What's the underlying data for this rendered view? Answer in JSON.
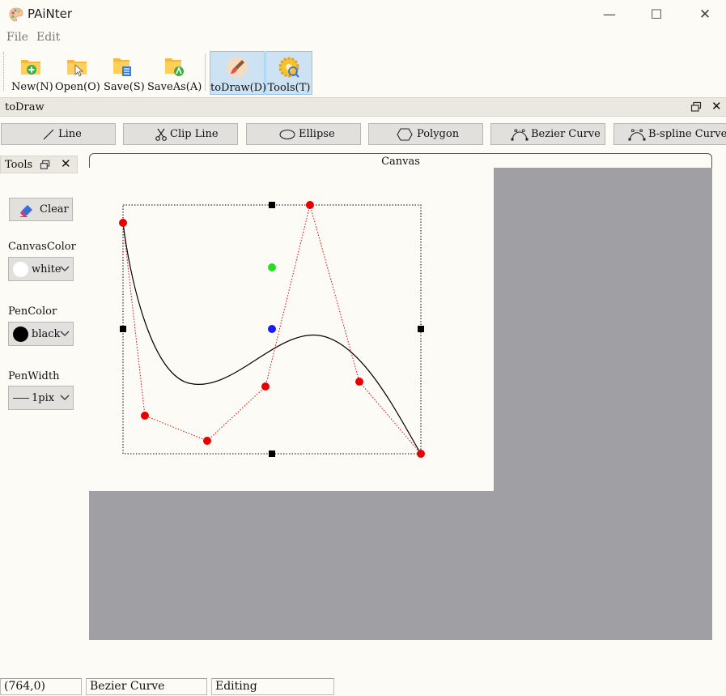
{
  "window": {
    "title": "PAiNter",
    "minimize_glyph": "—",
    "maximize_glyph": "☐",
    "close_glyph": "✕"
  },
  "menu": [
    "File",
    "Edit"
  ],
  "toolbar": [
    {
      "label": "New(N)",
      "icon": "folder-new-icon"
    },
    {
      "label": "Open(O)",
      "icon": "folder-open-icon"
    },
    {
      "label": "Save(S)",
      "icon": "save-icon"
    },
    {
      "label": "SaveAs(A)",
      "icon": "save-as-icon"
    },
    {
      "label": "toDraw(D)",
      "icon": "brush-icon",
      "active": true
    },
    {
      "label": "Tools(T)",
      "icon": "gear-icon",
      "active": true
    }
  ],
  "dock": {
    "title": "toDraw",
    "close_glyph": "✕"
  },
  "shapes": [
    {
      "label": "Line",
      "icon": "line-icon"
    },
    {
      "label": "Clip Line",
      "icon": "scissors-icon"
    },
    {
      "label": "Ellipse",
      "icon": "ellipse-icon"
    },
    {
      "label": "Polygon",
      "icon": "polygon-icon"
    },
    {
      "label": "Bezier Curve",
      "icon": "bezier-icon"
    },
    {
      "label": "B-spline Curve",
      "icon": "bspline-icon"
    }
  ],
  "tools": {
    "title": "Tools",
    "close_glyph": "✕",
    "clear_label": "Clear",
    "canvas_color_label": "CanvasColor",
    "canvas_color_value": "white",
    "pen_color_label": "PenColor",
    "pen_color_value": "black",
    "pen_width_label": "PenWidth",
    "pen_width_value": "1pix"
  },
  "canvas": {
    "tab_label": "Canvas",
    "background_color": "#fdfbf6",
    "workspace_color": "#a09fa4"
  },
  "colors": {
    "control_point": "#e60000",
    "control_polygon": "#e60000",
    "curve": "#000000",
    "center_handle": "#1a1aff",
    "rotate_handle": "#22e022",
    "active_button": "#cde3f3"
  },
  "status": {
    "coords": "(764,0)",
    "mode": "Bezier Curve",
    "state": "Editing"
  }
}
